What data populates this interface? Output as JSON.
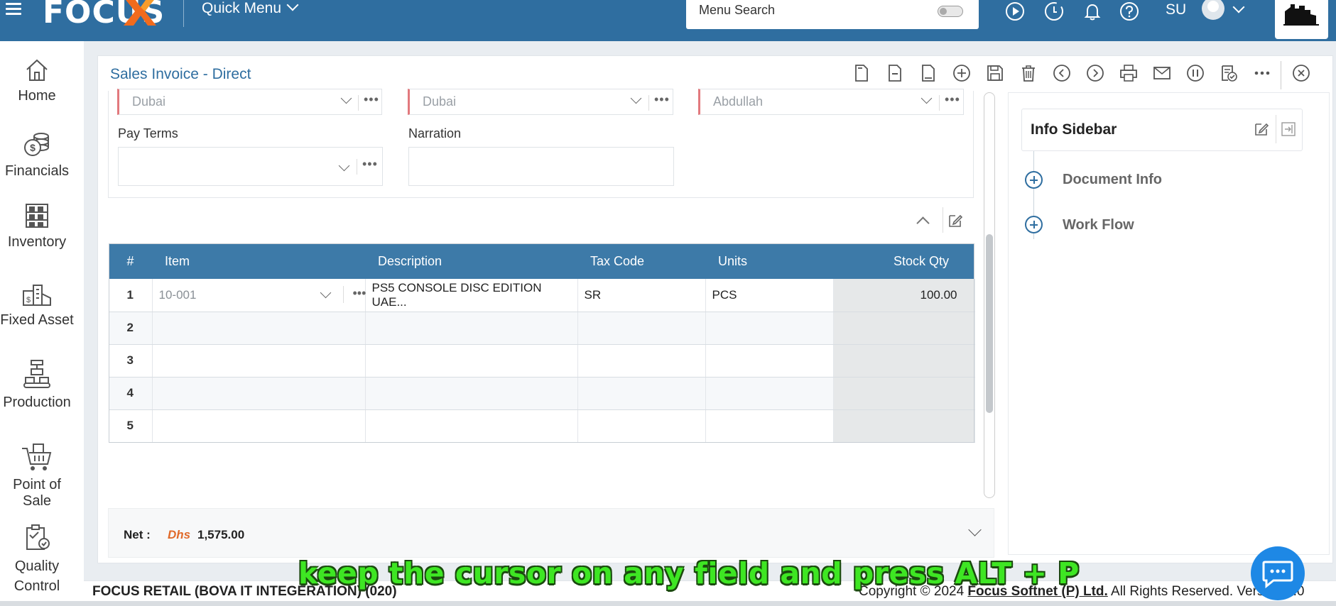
{
  "topbar": {
    "logo_text": "FOCUS",
    "quick_menu_label": "Quick Menu",
    "search_placeholder": "Menu Search",
    "user_initials": "SU",
    "accent_color": "#2f6ea0",
    "icons": [
      "play-icon",
      "clock-icon",
      "bell-icon",
      "help-icon"
    ]
  },
  "leftnav": {
    "items": [
      {
        "label": "Home",
        "icon": "home-icon"
      },
      {
        "label": "Financials",
        "icon": "coins-icon"
      },
      {
        "label": "Inventory",
        "icon": "shelves-icon"
      },
      {
        "label": "Fixed Asset",
        "icon": "building-icon"
      },
      {
        "label": "Production",
        "icon": "conveyor-icon"
      },
      {
        "label": "Point of Sale",
        "icon": "cart-icon"
      },
      {
        "label": "Quality Control",
        "line1": "Quality",
        "line2": "Control",
        "icon": "clipboard-icon"
      }
    ]
  },
  "document": {
    "title": "Sales Invoice - Direct",
    "toolbar": [
      "new-icon",
      "minus-doc-icon",
      "doc-icon",
      "add-icon",
      "save-icon",
      "delete-icon",
      "previous-icon",
      "next-icon",
      "print-icon",
      "email-icon",
      "pause-icon",
      "checklist-icon",
      "more-icon",
      "close-icon"
    ]
  },
  "header_fields": {
    "field1_value": "Dubai",
    "field2_value": "Dubai",
    "field3_value": "Abdullah",
    "pay_terms_label": "Pay Terms",
    "pay_terms_value": "",
    "narration_label": "Narration",
    "narration_value": ""
  },
  "grid": {
    "columns": [
      "#",
      "Item",
      "Description",
      "Tax Code",
      "Units",
      "Stock Qty"
    ],
    "rows": [
      {
        "num": "1",
        "item": "10-001",
        "description": "PS5 CONSOLE DISC EDITION UAE...",
        "tax_code": "SR",
        "units": "PCS",
        "stock_qty": "100.00"
      },
      {
        "num": "2",
        "item": "",
        "description": "",
        "tax_code": "",
        "units": "",
        "stock_qty": ""
      },
      {
        "num": "3",
        "item": "",
        "description": "",
        "tax_code": "",
        "units": "",
        "stock_qty": ""
      },
      {
        "num": "4",
        "item": "",
        "description": "",
        "tax_code": "",
        "units": "",
        "stock_qty": ""
      },
      {
        "num": "5",
        "item": "",
        "description": "",
        "tax_code": "",
        "units": "",
        "stock_qty": ""
      }
    ]
  },
  "net": {
    "label": "Net :",
    "currency": "Dhs",
    "value": "1,575.00"
  },
  "sidebar": {
    "title": "Info Sidebar",
    "items": [
      {
        "label": "Document Info"
      },
      {
        "label": "Work Flow"
      }
    ]
  },
  "statusbar": {
    "company": "FOCUS RETAIL (BOVA IT INTEGERATION) (020)",
    "copyright_prefix": "Copyright © 2024 ",
    "copyright_company": "Focus Softnet (P) Ltd.",
    "copyright_suffix": " All Rights Reserved. Version 1.0"
  },
  "caption": "keep the cursor on any field and press ALT + P"
}
